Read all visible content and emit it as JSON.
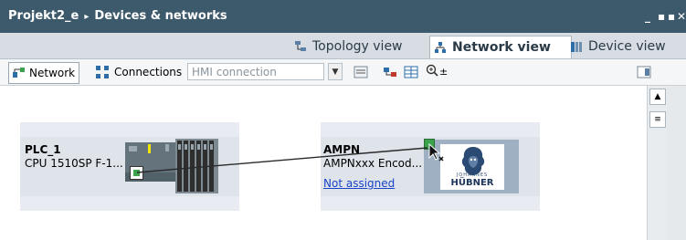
{
  "window": {
    "project": "Projekt2_e",
    "separator": "▸",
    "section": "Devices & networks",
    "controls": [
      "_",
      "▪",
      "▪",
      "✕"
    ]
  },
  "views": {
    "topology": "Topology view",
    "network": "Network view",
    "device": "Device view"
  },
  "toolbar": {
    "network": "Network",
    "connections": "Connections",
    "hmi_connection": "HMI connection",
    "zoom": "±"
  },
  "devices": {
    "plc": {
      "name": "PLC_1",
      "type": "CPU 1510SP F-1..."
    },
    "ampn": {
      "name": "AMPN",
      "type": "AMPNxxx Encod...",
      "assignment": "Not assigned",
      "logo_text": "HÜBNER",
      "logo_subtext": "JOHANNES"
    }
  },
  "colors": {
    "titlebar": "#3d5a6c",
    "viewbar": "#d7dde3",
    "device_bg": "#dfe3ea",
    "port_green": "#3aa34b",
    "link_blue": "#1a44c9"
  }
}
